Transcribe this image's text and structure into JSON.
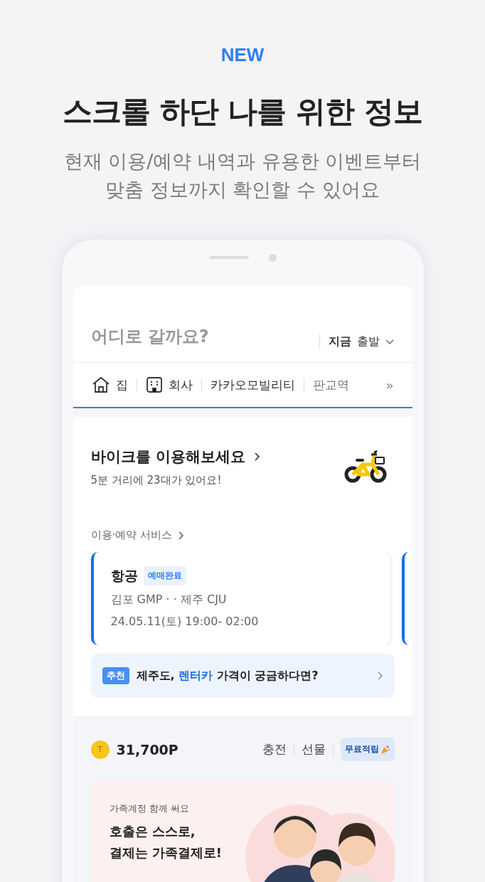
{
  "header": {
    "badge": "NEW",
    "title": "스크롤 하단 나를 위한 정보",
    "subtitle": "현재 이용/예약 내역과 유용한 이벤트부터\n맞춤 정보까지 확인할 수 있어요"
  },
  "search": {
    "placeholder": "어디로 갈까요?",
    "departure": "**지금** 출발"
  },
  "places": [
    {
      "kind": "home",
      "label": "집"
    },
    {
      "kind": "office",
      "label": "회사"
    },
    {
      "kind": "text",
      "label": "카카오모빌리티"
    },
    {
      "kind": "text",
      "label": "판교역"
    }
  ],
  "places_more": "»",
  "bike": {
    "title": "바이크를 이용해보세요",
    "subtitle": "5분 거리에 23대가 있어요!"
  },
  "services": {
    "title": "이용·예약 서비스",
    "cards": [
      {
        "category": "항공",
        "status": "예매완료",
        "route": "김포 GMP · · 제주 CJU",
        "schedule": "24.05.11(토) 19:00- 02:00"
      }
    ]
  },
  "recommend": {
    "badge": "추천",
    "parts": [
      {
        "text": "제주도, ",
        "highlight": false
      },
      {
        "text": "렌터카",
        "highlight": true
      },
      {
        "text": " 가격이 궁금하다면?",
        "highlight": false
      }
    ]
  },
  "points": {
    "coin": "T",
    "amount": "31,700P",
    "actions": [
      "충전",
      "선물"
    ],
    "earn_button": "무료적립"
  },
  "family": {
    "subtitle": "가족계정 함께 써요",
    "title": "호출은 스스로,\n결제는 가족결제로!"
  }
}
